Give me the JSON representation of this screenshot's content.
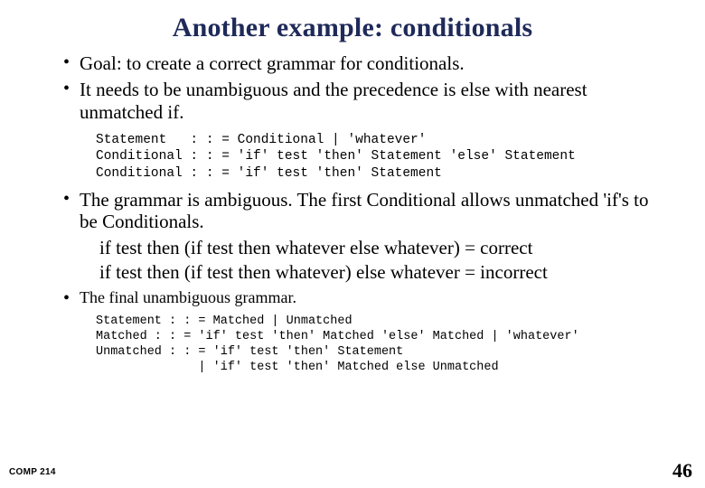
{
  "title": "Another example: conditionals",
  "bullets": {
    "b1": "Goal: to create a correct grammar for conditionals.",
    "b2": "It needs to be unambiguous and the precedence is else with nearest unmatched if.",
    "b3": "The grammar is ambiguous. The first Conditional allows unmatched 'if's to be Conditionals.",
    "b3_line1": "if test then (if test then whatever else whatever) = correct",
    "b3_line2": "if test then (if test then whatever) else whatever = incorrect",
    "b4": "The final unambiguous grammar."
  },
  "code1": "Statement   : : = Conditional | 'whatever'\nConditional : : = 'if' test 'then' Statement 'else' Statement\nConditional : : = 'if' test 'then' Statement",
  "code2": "Statement : : = Matched | Unmatched\nMatched : : = 'if' test 'then' Matched 'else' Matched | 'whatever'\nUnmatched : : = 'if' test 'then' Statement\n              | 'if' test 'then' Matched else Unmatched",
  "footer": {
    "course": "COMP 214",
    "page": "46"
  }
}
